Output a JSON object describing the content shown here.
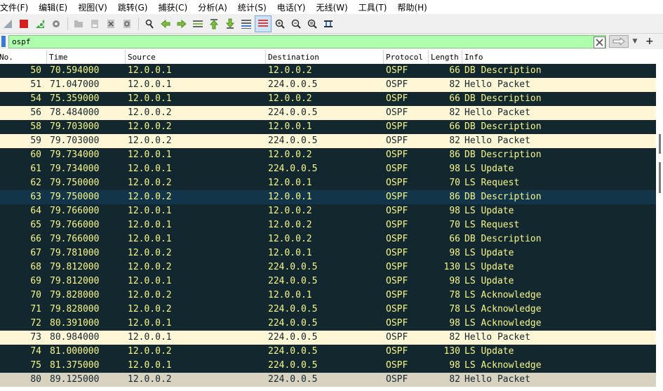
{
  "menu": [
    "文件(F)",
    "编辑(E)",
    "视图(V)",
    "跳转(G)",
    "捕获(C)",
    "分析(A)",
    "统计(S)",
    "电话(Y)",
    "无线(W)",
    "工具(T)",
    "帮助(H)"
  ],
  "toolbar_icons": [
    "shark-fin-icon",
    "stop-icon",
    "restart-icon",
    "options-gear-icon",
    "open-folder-icon",
    "save-file-icon",
    "close-file-icon",
    "reload-icon",
    "find-icon",
    "go-back-icon",
    "go-forward-icon",
    "go-to-packet-icon",
    "first-packet-icon",
    "last-packet-icon",
    "autoscroll-icon",
    "colorize-icon",
    "zoom-in-icon",
    "zoom-out-icon",
    "zoom-reset-icon",
    "resize-columns-icon"
  ],
  "filter": {
    "value": "ospf"
  },
  "columns": {
    "no": "No.",
    "time": "Time",
    "source": "Source",
    "destination": "Destination",
    "protocol": "Protocol",
    "length": "Length",
    "info": "Info"
  },
  "packets": [
    {
      "no": "50",
      "time": "70.594000",
      "src": "12.0.0.1",
      "dst": "12.0.0.2",
      "proto": "OSPF",
      "len": "66",
      "info": "DB Description",
      "style": "dark"
    },
    {
      "no": "51",
      "time": "71.047000",
      "src": "12.0.0.1",
      "dst": "224.0.0.5",
      "proto": "OSPF",
      "len": "82",
      "info": "Hello Packet",
      "style": "hello"
    },
    {
      "no": "54",
      "time": "75.359000",
      "src": "12.0.0.1",
      "dst": "12.0.0.2",
      "proto": "OSPF",
      "len": "66",
      "info": "DB Description",
      "style": "dark"
    },
    {
      "no": "56",
      "time": "78.484000",
      "src": "12.0.0.2",
      "dst": "224.0.0.5",
      "proto": "OSPF",
      "len": "82",
      "info": "Hello Packet",
      "style": "hello"
    },
    {
      "no": "58",
      "time": "79.703000",
      "src": "12.0.0.2",
      "dst": "12.0.0.1",
      "proto": "OSPF",
      "len": "66",
      "info": "DB Description",
      "style": "dark"
    },
    {
      "no": "59",
      "time": "79.703000",
      "src": "12.0.0.2",
      "dst": "224.0.0.5",
      "proto": "OSPF",
      "len": "82",
      "info": "Hello Packet",
      "style": "hello"
    },
    {
      "no": "60",
      "time": "79.734000",
      "src": "12.0.0.1",
      "dst": "12.0.0.2",
      "proto": "OSPF",
      "len": "86",
      "info": "DB Description",
      "style": "dark"
    },
    {
      "no": "61",
      "time": "79.734000",
      "src": "12.0.0.1",
      "dst": "224.0.0.5",
      "proto": "OSPF",
      "len": "98",
      "info": "LS Update",
      "style": "dark"
    },
    {
      "no": "62",
      "time": "79.750000",
      "src": "12.0.0.2",
      "dst": "12.0.0.1",
      "proto": "OSPF",
      "len": "70",
      "info": "LS Request",
      "style": "dark"
    },
    {
      "no": "63",
      "time": "79.750000",
      "src": "12.0.0.2",
      "dst": "12.0.0.1",
      "proto": "OSPF",
      "len": "86",
      "info": "DB Description",
      "style": "selected"
    },
    {
      "no": "64",
      "time": "79.766000",
      "src": "12.0.0.1",
      "dst": "12.0.0.2",
      "proto": "OSPF",
      "len": "98",
      "info": "LS Update",
      "style": "dark"
    },
    {
      "no": "65",
      "time": "79.766000",
      "src": "12.0.0.1",
      "dst": "12.0.0.2",
      "proto": "OSPF",
      "len": "70",
      "info": "LS Request",
      "style": "dark"
    },
    {
      "no": "66",
      "time": "79.766000",
      "src": "12.0.0.1",
      "dst": "12.0.0.2",
      "proto": "OSPF",
      "len": "66",
      "info": "DB Description",
      "style": "dark"
    },
    {
      "no": "67",
      "time": "79.781000",
      "src": "12.0.0.2",
      "dst": "12.0.0.1",
      "proto": "OSPF",
      "len": "98",
      "info": "LS Update",
      "style": "dark"
    },
    {
      "no": "68",
      "time": "79.812000",
      "src": "12.0.0.2",
      "dst": "224.0.0.5",
      "proto": "OSPF",
      "len": "130",
      "info": "LS Update",
      "style": "dark"
    },
    {
      "no": "69",
      "time": "79.812000",
      "src": "12.0.0.1",
      "dst": "224.0.0.5",
      "proto": "OSPF",
      "len": "98",
      "info": "LS Update",
      "style": "dark"
    },
    {
      "no": "70",
      "time": "79.828000",
      "src": "12.0.0.2",
      "dst": "12.0.0.1",
      "proto": "OSPF",
      "len": "78",
      "info": "LS Acknowledge",
      "style": "dark"
    },
    {
      "no": "71",
      "time": "79.828000",
      "src": "12.0.0.2",
      "dst": "224.0.0.5",
      "proto": "OSPF",
      "len": "78",
      "info": "LS Acknowledge",
      "style": "dark"
    },
    {
      "no": "72",
      "time": "80.391000",
      "src": "12.0.0.1",
      "dst": "224.0.0.5",
      "proto": "OSPF",
      "len": "98",
      "info": "LS Acknowledge",
      "style": "dark"
    },
    {
      "no": "73",
      "time": "80.984000",
      "src": "12.0.0.1",
      "dst": "224.0.0.5",
      "proto": "OSPF",
      "len": "82",
      "info": "Hello Packet",
      "style": "hello"
    },
    {
      "no": "74",
      "time": "81.000000",
      "src": "12.0.0.2",
      "dst": "224.0.0.5",
      "proto": "OSPF",
      "len": "130",
      "info": "LS Update",
      "style": "dark"
    },
    {
      "no": "75",
      "time": "81.375000",
      "src": "12.0.0.1",
      "dst": "224.0.0.5",
      "proto": "OSPF",
      "len": "98",
      "info": "LS Acknowledge",
      "style": "dark"
    },
    {
      "no": "80",
      "time": "89.125000",
      "src": "12.0.0.2",
      "dst": "224.0.0.5",
      "proto": "OSPF",
      "len": "82",
      "info": "Hello Packet",
      "style": "hello-sel"
    }
  ],
  "colors": {
    "dark_row": "#12272e",
    "dark_text": "#f7f78a",
    "hello_row": "#fef6d5",
    "filter_ok": "#afffaf"
  }
}
